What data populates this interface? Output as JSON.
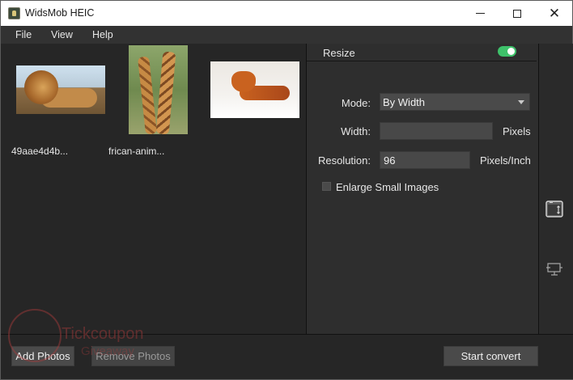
{
  "window": {
    "title": "WidsMob HEIC",
    "min_label": "",
    "max_label": "",
    "close_label": "✕"
  },
  "menu": {
    "items": [
      "File",
      "View",
      "Help"
    ]
  },
  "photos": {
    "items": [
      {
        "label": "49aae4d4b..."
      },
      {
        "label": "frican-anim..."
      },
      {
        "label": ""
      }
    ]
  },
  "settings": {
    "section_title": "Resize",
    "resize_enabled": true,
    "mode_label": "Mode:",
    "mode_value": "By Width",
    "width_label": "Width:",
    "width_value": "",
    "width_unit": "Pixels",
    "resolution_label": "Resolution:",
    "resolution_value": "96",
    "resolution_unit": "Pixels/Inch",
    "enlarge_label": "Enlarge Small Images",
    "enlarge_checked": false
  },
  "tools": {
    "items": [
      "resize-tool-icon",
      "crop-tool-icon"
    ]
  },
  "actions": {
    "add_label": "Add Photos",
    "remove_label": "Remove Photos",
    "start_label": "Start convert"
  },
  "watermark": {
    "line1": "Tickcoupon",
    "line2": "Giveaway"
  },
  "colors": {
    "toggle_on": "#3ec16a",
    "panel_bg": "#2e2e2e",
    "button_bg": "#4a4a4a"
  }
}
